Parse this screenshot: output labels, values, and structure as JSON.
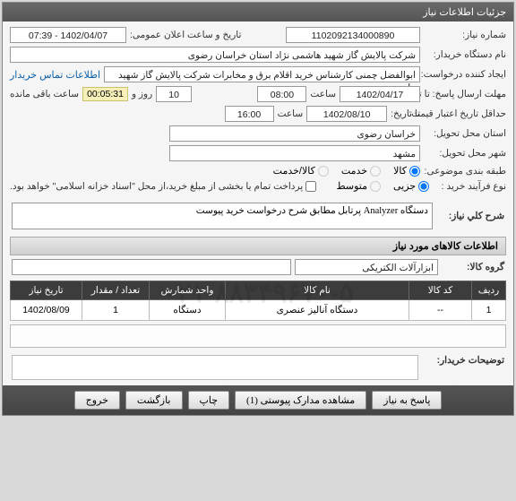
{
  "titlebar": "جزئیات اطلاعات نیاز",
  "labels": {
    "need_no": "شماره نیاز:",
    "pub_datetime": "تاریخ و ساعت اعلان عمومی:",
    "buyer_org": "نام دستگاه خریدار:",
    "requester": "ایجاد کننده درخواست:",
    "contact_link": "اطلاعات تماس خریدار",
    "reply_deadline": "مهلت ارسال پاسخ:",
    "to_date": "تا تاریخ:",
    "hour": "ساعت",
    "days_and": "روز و",
    "remaining": "ساعت باقی مانده",
    "price_valid": "حداقل تاریخ اعتبار قیمت:",
    "province": "استان محل تحویل:",
    "city": "شهر محل تحویل:",
    "subject_class": "طبقه بندی موضوعی:",
    "purchase_type": "نوع فرآیند خرید :",
    "payment_note": "پرداخت تمام یا بخشی از مبلغ خرید،از محل \"اسناد خزانه اسلامی\" خواهد بود.",
    "desc_title": "شرح کلي نیاز:",
    "items_section": "اطلاعات کالاهای مورد نیاز",
    "group": "گروه کالا:",
    "buyer_notes": "توضیحات خریدار:"
  },
  "fields": {
    "need_no": "1102092134000890",
    "pub_datetime": "1402/04/07 - 07:39",
    "buyer_org": "شرکت پالایش گاز شهید هاشمی نژاد   استان خراسان رضوی",
    "requester": "ابوالفضل چمنی کارشناس خرید اقلام برق و مخابرات شرکت پالایش گاز شهید ها",
    "deadline_date": "1402/04/17",
    "deadline_time": "08:00",
    "deadline_days": "10",
    "countdown": "00:05:31",
    "price_valid_date": "1402/08/10",
    "price_valid_time": "16:00",
    "province": "خراسان رضوی",
    "city": "مشهد",
    "desc": "دستگاه Analyzer پرتابل مطابق شرح درخواست خرید پیوست",
    "group": "ابزارآلات الکتریکی"
  },
  "radios": {
    "subject": {
      "opt1": "کالا",
      "opt2": "خدمت",
      "opt3": "کالا/خدمت"
    },
    "purchase": {
      "opt1": "جزیی",
      "opt2": "متوسط"
    }
  },
  "grid": {
    "headers": {
      "row": "ردیف",
      "code": "کد کالا",
      "name": "نام کالا",
      "unit": "واحد شمارش",
      "qty": "تعداد / مقدار",
      "date": "تاریخ نیاز"
    },
    "row1": {
      "row": "1",
      "code": "--",
      "name": "دستگاه آنالیز عنصری",
      "unit": "دستگاه",
      "qty": "1",
      "date": "1402/08/09"
    }
  },
  "footer": {
    "reply": "پاسخ به نیاز",
    "attach": "مشاهده مدارک پیوستی (1)",
    "print": "چاپ",
    "back": "بازگشت",
    "exit": "خروج"
  },
  "watermark": "۰۲۱-۸۸۳۴۹۶۷۰-۵"
}
